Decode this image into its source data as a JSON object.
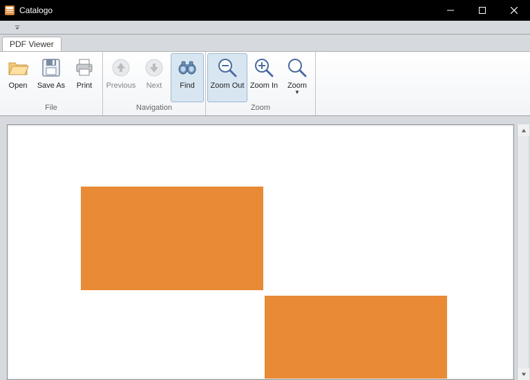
{
  "window": {
    "title": "Catalogo",
    "controls": {
      "minimize": "Minimize",
      "maximize": "Maximize",
      "close": "Close"
    }
  },
  "ribbon": {
    "tabs": [
      {
        "label": "PDF Viewer",
        "active": true
      }
    ],
    "groups": {
      "file": {
        "label": "File",
        "buttons": {
          "open": "Open",
          "save_as": "Save As",
          "print": "Print"
        }
      },
      "navigation": {
        "label": "Navigation",
        "buttons": {
          "previous": "Previous",
          "next": "Next",
          "find": "Find"
        }
      },
      "zoom": {
        "label": "Zoom",
        "buttons": {
          "zoom_out": "Zoom Out",
          "zoom_in": "Zoom In",
          "zoom": "Zoom"
        }
      }
    }
  },
  "colors": {
    "orange": "#e88a36"
  }
}
